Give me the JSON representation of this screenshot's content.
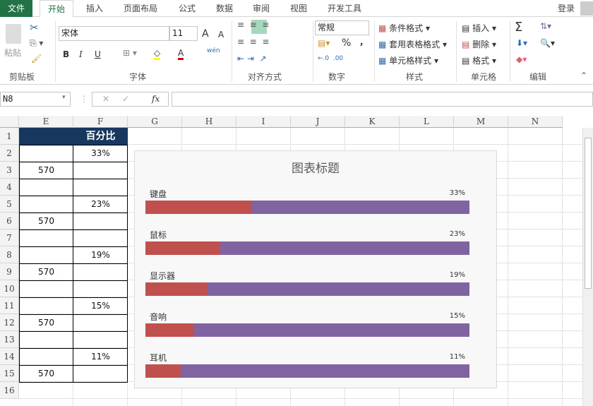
{
  "tabs": {
    "file": "文件",
    "items": [
      "开始",
      "插入",
      "页面布局",
      "公式",
      "数据",
      "审阅",
      "视图",
      "开发工具"
    ],
    "active": "开始",
    "login": "登录"
  },
  "ribbon": {
    "clipboard": {
      "paste": "粘贴",
      "label": "剪贴板"
    },
    "font": {
      "name": "宋体",
      "size": "11",
      "bold": "B",
      "italic": "I",
      "underline": "U",
      "phonetic": "wén",
      "label": "字体",
      "highlight_color": "#ffff00",
      "font_color": "#e00000"
    },
    "alignment": {
      "label": "对齐方式"
    },
    "number": {
      "format": "常规",
      "percent": "%",
      "comma": ",",
      "label": "数字"
    },
    "styles": {
      "conditional": "条件格式",
      "table": "套用表格格式",
      "cell": "单元格样式",
      "label": "样式"
    },
    "cells": {
      "insert": "插入",
      "delete": "删除",
      "format": "格式",
      "label": "单元格"
    },
    "editing": {
      "label": "编辑"
    }
  },
  "formula_bar": {
    "name_box": "N8",
    "fx": "fx",
    "value": ""
  },
  "columns": [
    "E",
    "F",
    "G",
    "H",
    "I",
    "J",
    "K",
    "L",
    "M",
    "N"
  ],
  "rows": [
    "1",
    "2",
    "3",
    "4",
    "5",
    "6",
    "7",
    "8",
    "9",
    "10",
    "11",
    "12",
    "13",
    "14",
    "15",
    "16"
  ],
  "cells": {
    "F1": "百分比",
    "F2": "33%",
    "E3": "570",
    "F5": "23%",
    "E6": "570",
    "F8": "19%",
    "E9": "570",
    "F11": "15%",
    "E12": "570",
    "F14": "11%",
    "E15": "570"
  },
  "header_fill": "#17375e",
  "chart_data": {
    "type": "bar",
    "title": "图表标题",
    "categories": [
      "键盘",
      "鼠标",
      "显示器",
      "音响",
      "耳机"
    ],
    "series": [
      {
        "values": [
          33,
          23,
          19,
          15,
          11
        ],
        "color": "#c0504d"
      },
      {
        "values": [
          100,
          100,
          100,
          100,
          100
        ],
        "color": "#8064a2"
      }
    ],
    "data_labels": [
      "33%",
      "23%",
      "19%",
      "15%",
      "11%"
    ],
    "xlim": [
      0,
      100
    ]
  }
}
